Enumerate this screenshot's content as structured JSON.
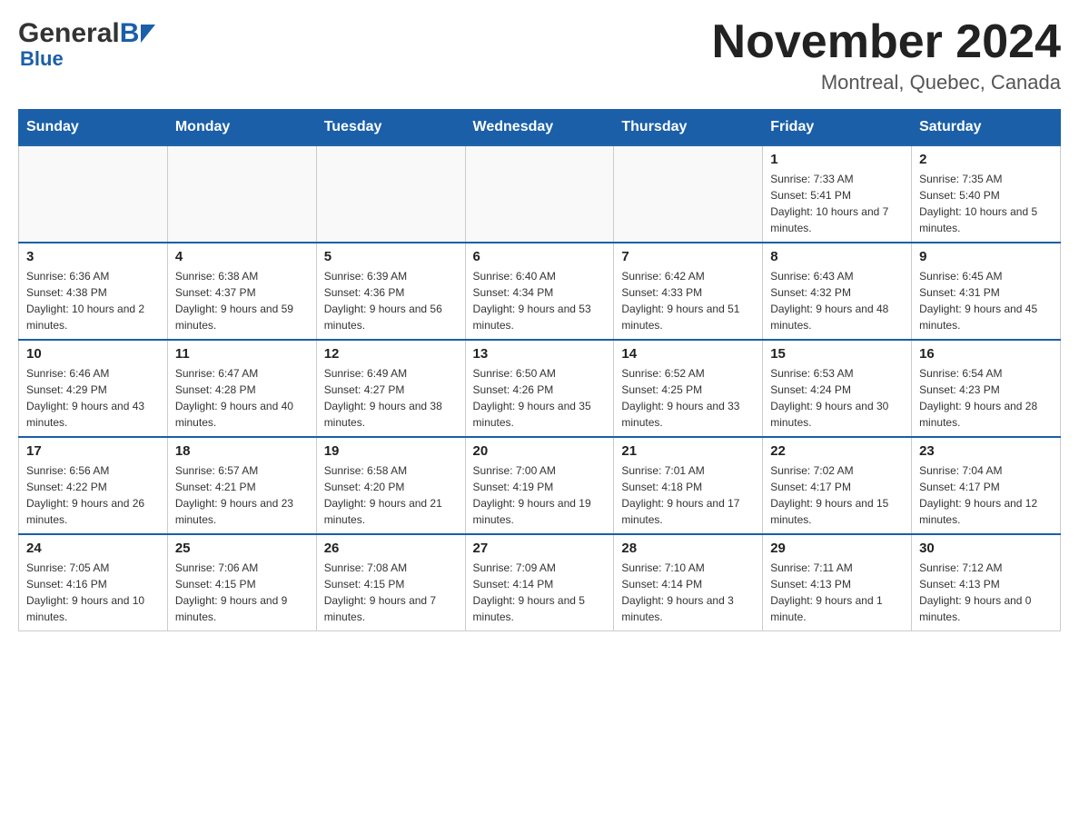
{
  "logo": {
    "general": "General",
    "blue": "Blue"
  },
  "header": {
    "month_year": "November 2024",
    "location": "Montreal, Quebec, Canada"
  },
  "weekdays": [
    "Sunday",
    "Monday",
    "Tuesday",
    "Wednesday",
    "Thursday",
    "Friday",
    "Saturday"
  ],
  "weeks": [
    {
      "days": [
        {
          "number": "",
          "info": "",
          "empty": true
        },
        {
          "number": "",
          "info": "",
          "empty": true
        },
        {
          "number": "",
          "info": "",
          "empty": true
        },
        {
          "number": "",
          "info": "",
          "empty": true
        },
        {
          "number": "",
          "info": "",
          "empty": true
        },
        {
          "number": "1",
          "info": "Sunrise: 7:33 AM\nSunset: 5:41 PM\nDaylight: 10 hours and 7 minutes.",
          "empty": false
        },
        {
          "number": "2",
          "info": "Sunrise: 7:35 AM\nSunset: 5:40 PM\nDaylight: 10 hours and 5 minutes.",
          "empty": false
        }
      ]
    },
    {
      "days": [
        {
          "number": "3",
          "info": "Sunrise: 6:36 AM\nSunset: 4:38 PM\nDaylight: 10 hours and 2 minutes.",
          "empty": false
        },
        {
          "number": "4",
          "info": "Sunrise: 6:38 AM\nSunset: 4:37 PM\nDaylight: 9 hours and 59 minutes.",
          "empty": false
        },
        {
          "number": "5",
          "info": "Sunrise: 6:39 AM\nSunset: 4:36 PM\nDaylight: 9 hours and 56 minutes.",
          "empty": false
        },
        {
          "number": "6",
          "info": "Sunrise: 6:40 AM\nSunset: 4:34 PM\nDaylight: 9 hours and 53 minutes.",
          "empty": false
        },
        {
          "number": "7",
          "info": "Sunrise: 6:42 AM\nSunset: 4:33 PM\nDaylight: 9 hours and 51 minutes.",
          "empty": false
        },
        {
          "number": "8",
          "info": "Sunrise: 6:43 AM\nSunset: 4:32 PM\nDaylight: 9 hours and 48 minutes.",
          "empty": false
        },
        {
          "number": "9",
          "info": "Sunrise: 6:45 AM\nSunset: 4:31 PM\nDaylight: 9 hours and 45 minutes.",
          "empty": false
        }
      ]
    },
    {
      "days": [
        {
          "number": "10",
          "info": "Sunrise: 6:46 AM\nSunset: 4:29 PM\nDaylight: 9 hours and 43 minutes.",
          "empty": false
        },
        {
          "number": "11",
          "info": "Sunrise: 6:47 AM\nSunset: 4:28 PM\nDaylight: 9 hours and 40 minutes.",
          "empty": false
        },
        {
          "number": "12",
          "info": "Sunrise: 6:49 AM\nSunset: 4:27 PM\nDaylight: 9 hours and 38 minutes.",
          "empty": false
        },
        {
          "number": "13",
          "info": "Sunrise: 6:50 AM\nSunset: 4:26 PM\nDaylight: 9 hours and 35 minutes.",
          "empty": false
        },
        {
          "number": "14",
          "info": "Sunrise: 6:52 AM\nSunset: 4:25 PM\nDaylight: 9 hours and 33 minutes.",
          "empty": false
        },
        {
          "number": "15",
          "info": "Sunrise: 6:53 AM\nSunset: 4:24 PM\nDaylight: 9 hours and 30 minutes.",
          "empty": false
        },
        {
          "number": "16",
          "info": "Sunrise: 6:54 AM\nSunset: 4:23 PM\nDaylight: 9 hours and 28 minutes.",
          "empty": false
        }
      ]
    },
    {
      "days": [
        {
          "number": "17",
          "info": "Sunrise: 6:56 AM\nSunset: 4:22 PM\nDaylight: 9 hours and 26 minutes.",
          "empty": false
        },
        {
          "number": "18",
          "info": "Sunrise: 6:57 AM\nSunset: 4:21 PM\nDaylight: 9 hours and 23 minutes.",
          "empty": false
        },
        {
          "number": "19",
          "info": "Sunrise: 6:58 AM\nSunset: 4:20 PM\nDaylight: 9 hours and 21 minutes.",
          "empty": false
        },
        {
          "number": "20",
          "info": "Sunrise: 7:00 AM\nSunset: 4:19 PM\nDaylight: 9 hours and 19 minutes.",
          "empty": false
        },
        {
          "number": "21",
          "info": "Sunrise: 7:01 AM\nSunset: 4:18 PM\nDaylight: 9 hours and 17 minutes.",
          "empty": false
        },
        {
          "number": "22",
          "info": "Sunrise: 7:02 AM\nSunset: 4:17 PM\nDaylight: 9 hours and 15 minutes.",
          "empty": false
        },
        {
          "number": "23",
          "info": "Sunrise: 7:04 AM\nSunset: 4:17 PM\nDaylight: 9 hours and 12 minutes.",
          "empty": false
        }
      ]
    },
    {
      "days": [
        {
          "number": "24",
          "info": "Sunrise: 7:05 AM\nSunset: 4:16 PM\nDaylight: 9 hours and 10 minutes.",
          "empty": false
        },
        {
          "number": "25",
          "info": "Sunrise: 7:06 AM\nSunset: 4:15 PM\nDaylight: 9 hours and 9 minutes.",
          "empty": false
        },
        {
          "number": "26",
          "info": "Sunrise: 7:08 AM\nSunset: 4:15 PM\nDaylight: 9 hours and 7 minutes.",
          "empty": false
        },
        {
          "number": "27",
          "info": "Sunrise: 7:09 AM\nSunset: 4:14 PM\nDaylight: 9 hours and 5 minutes.",
          "empty": false
        },
        {
          "number": "28",
          "info": "Sunrise: 7:10 AM\nSunset: 4:14 PM\nDaylight: 9 hours and 3 minutes.",
          "empty": false
        },
        {
          "number": "29",
          "info": "Sunrise: 7:11 AM\nSunset: 4:13 PM\nDaylight: 9 hours and 1 minute.",
          "empty": false
        },
        {
          "number": "30",
          "info": "Sunrise: 7:12 AM\nSunset: 4:13 PM\nDaylight: 9 hours and 0 minutes.",
          "empty": false
        }
      ]
    }
  ]
}
